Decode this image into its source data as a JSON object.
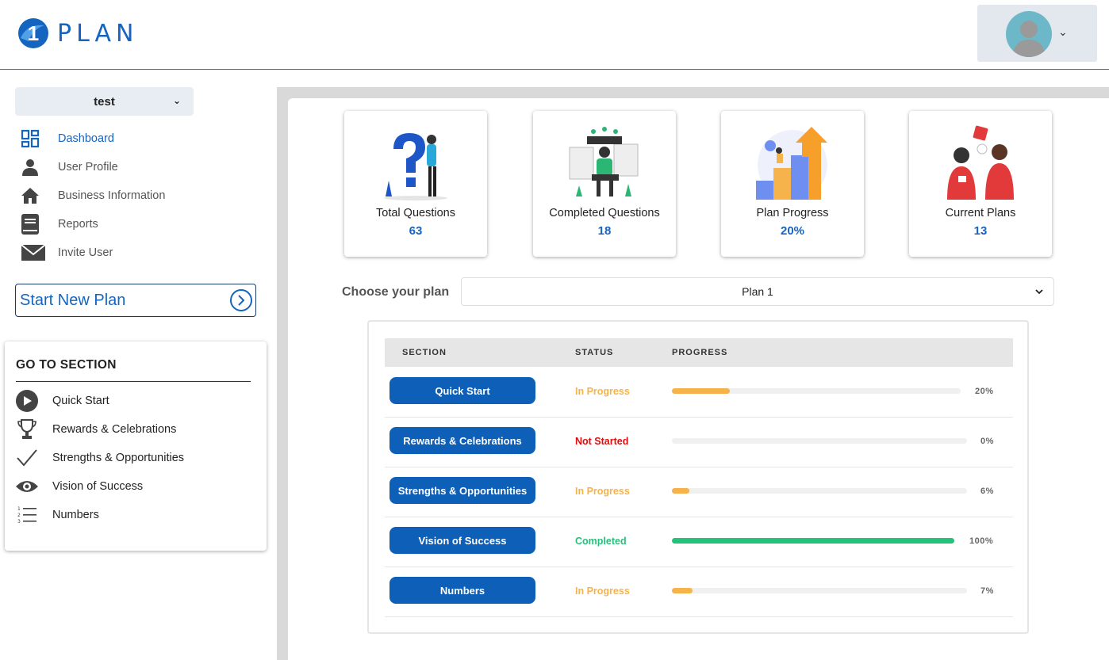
{
  "brand": {
    "logo_mark": "1",
    "logo_text": "PLAN",
    "accent": "#1565c0"
  },
  "header": {
    "user_avatar": "user-avatar",
    "menu_caret": "⌄"
  },
  "sidebar": {
    "company": "test",
    "company_caret": "⌄",
    "nav": [
      {
        "label": "Dashboard",
        "icon": "dashboard-icon",
        "active": true
      },
      {
        "label": "User Profile",
        "icon": "user-icon"
      },
      {
        "label": "Business Information",
        "icon": "home-icon"
      },
      {
        "label": "Reports",
        "icon": "book-icon"
      },
      {
        "label": "Invite User",
        "icon": "envelope-icon"
      }
    ],
    "start_plan": "Start New Plan",
    "goto": {
      "title": "GO TO SECTION",
      "items": [
        {
          "label": "Quick Start",
          "icon": "play-icon"
        },
        {
          "label": "Rewards & Celebrations",
          "icon": "trophy-icon"
        },
        {
          "label": "Strengths & Opportunities",
          "icon": "checkmark-icon"
        },
        {
          "label": "Vision of Success",
          "icon": "eye-icon"
        },
        {
          "label": "Numbers",
          "icon": "numbered-list-icon"
        }
      ]
    }
  },
  "stats": [
    {
      "label": "Total Questions",
      "value": "63"
    },
    {
      "label": "Completed Questions",
      "value": "18"
    },
    {
      "label": "Plan Progress",
      "value": "20%"
    },
    {
      "label": "Current Plans",
      "value": "13"
    }
  ],
  "plan_chooser": {
    "label": "Choose your plan",
    "selected": "Plan 1"
  },
  "table": {
    "headers": {
      "section": "SECTION",
      "status": "STATUS",
      "progress": "PROGRESS"
    },
    "rows": [
      {
        "section": "Quick Start",
        "status": "In Progress",
        "progress": 20,
        "progress_label": "20%"
      },
      {
        "section": "Rewards & Celebrations",
        "status": "Not Started",
        "progress": 0,
        "progress_label": "0%"
      },
      {
        "section": "Strengths & Opportunities",
        "status": "In Progress",
        "progress": 6,
        "progress_label": "6%"
      },
      {
        "section": "Vision of Success",
        "status": "Completed",
        "progress": 100,
        "progress_label": "100%"
      },
      {
        "section": "Numbers",
        "status": "In Progress",
        "progress": 7,
        "progress_label": "7%"
      }
    ]
  },
  "colors": {
    "in_progress": "#f6b24b",
    "not_started": "#e30c0c",
    "completed": "#24c27a",
    "button": "#0d5fb8"
  }
}
